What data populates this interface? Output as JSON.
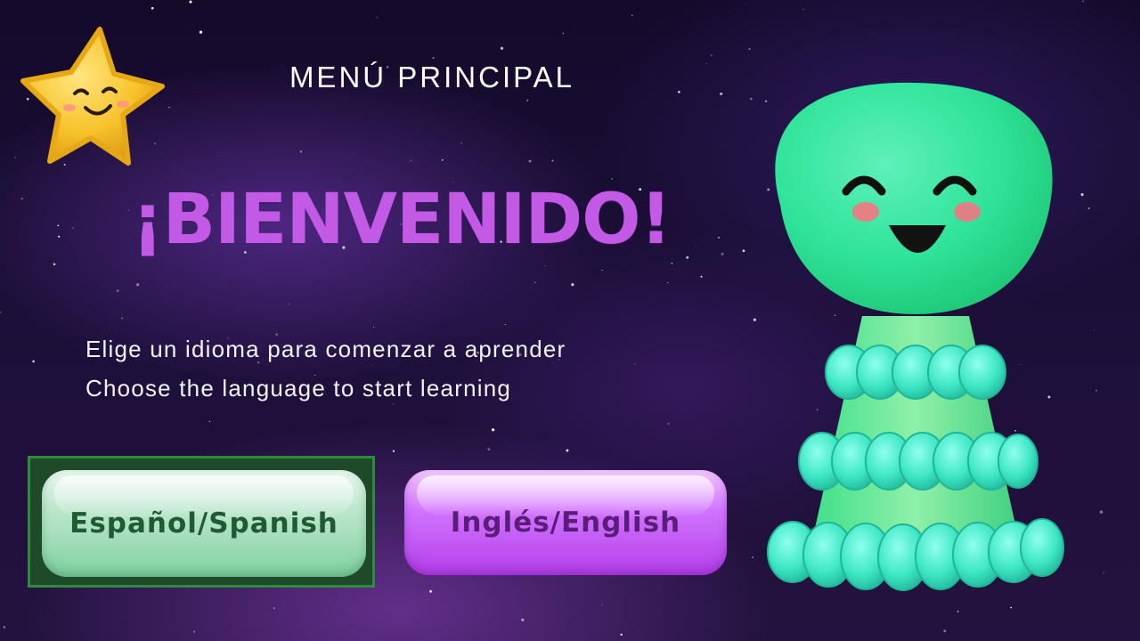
{
  "header": {
    "title": "MENÚ PRINCIPAL"
  },
  "welcome": {
    "heading": "¡BIENVENIDO!"
  },
  "instructions": {
    "spanish": "Elige un idioma para comenzar a aprender",
    "english": "Choose the language to start learning"
  },
  "buttons": {
    "spanish": "Español/Spanish",
    "english": "Inglés/English"
  },
  "icons": {
    "star": "smiling-star-mascot",
    "character": "green-smiling-mascot"
  },
  "colors": {
    "heading": "#c35ae6",
    "spanish_button": "#9fdcb6",
    "english_button": "#c95af0",
    "focus_frame": "#2f8a3e"
  }
}
